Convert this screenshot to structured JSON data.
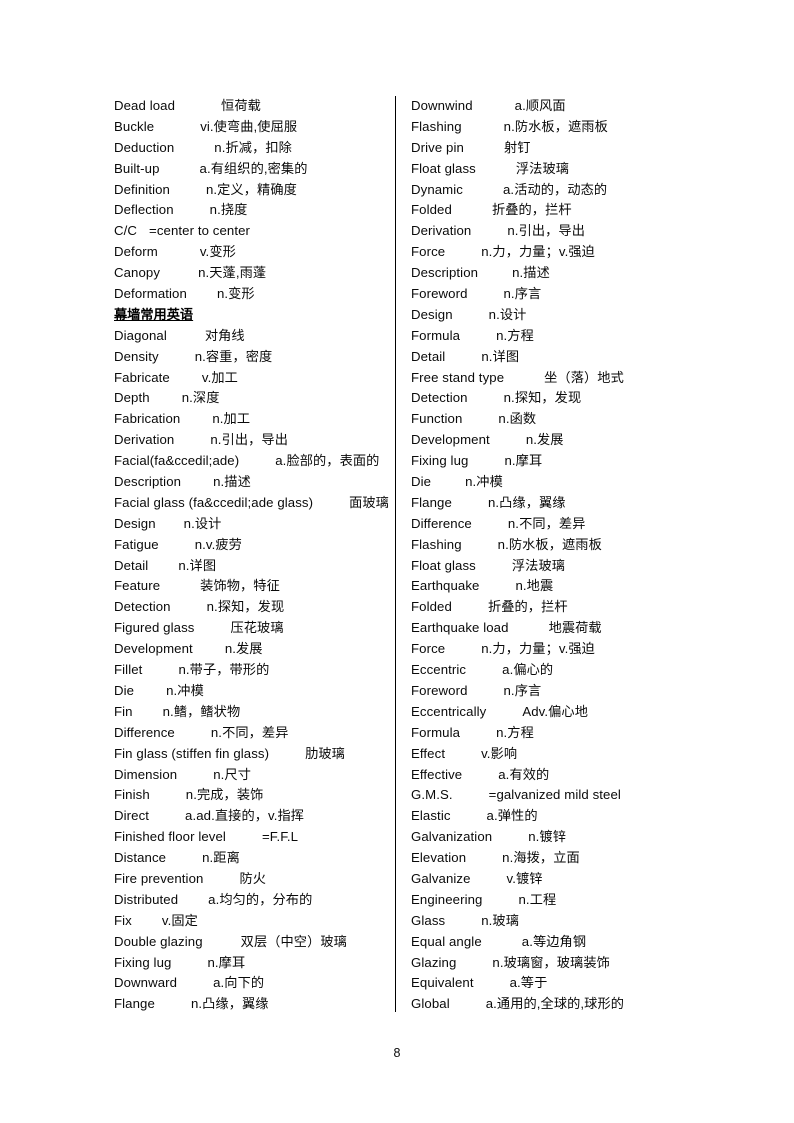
{
  "page": {
    "number": "8"
  },
  "columns": {
    "left": {
      "entries": [
        {
          "type": "entry",
          "term": "Dead load",
          "gap": 46,
          "def": "恒荷载"
        },
        {
          "type": "entry",
          "term": "Buckle",
          "gap": 46,
          "def": "vi.使弯曲,使屈服"
        },
        {
          "type": "entry",
          "term": "Deduction",
          "gap": 40,
          "def": "n.折减，扣除"
        },
        {
          "type": "entry",
          "term": "Built-up",
          "gap": 40,
          "def": "a.有组织的,密集的"
        },
        {
          "type": "entry",
          "term": "Definition",
          "gap": 36,
          "def": "n.定义，精确度"
        },
        {
          "type": "entry",
          "term": "Deflection",
          "gap": 36,
          "def": "n.挠度"
        },
        {
          "type": "entry",
          "term": "C/C",
          "gap": 12,
          "def": "=center to center"
        },
        {
          "type": "entry",
          "term": "Deform",
          "gap": 42,
          "def": "v.变形"
        },
        {
          "type": "entry",
          "term": "Canopy",
          "gap": 38,
          "def": "n.天蓬,雨蓬"
        },
        {
          "type": "entry",
          "term": "Deformation",
          "gap": 30,
          "def": "n.变形"
        },
        {
          "type": "head",
          "text": "幕墙常用英语"
        },
        {
          "type": "entry",
          "term": "Diagonal",
          "gap": 38,
          "def": "对角线"
        },
        {
          "type": "entry",
          "term": "Density",
          "gap": 36,
          "def": "n.容重，密度"
        },
        {
          "type": "entry",
          "term": "Fabricate",
          "gap": 32,
          "def": "v.加工"
        },
        {
          "type": "entry",
          "term": "Depth",
          "gap": 32,
          "def": "n.深度"
        },
        {
          "type": "entry",
          "term": "Fabrication",
          "gap": 32,
          "def": "n.加工"
        },
        {
          "type": "entry",
          "term": "Derivation",
          "gap": 36,
          "def": "n.引出，导出"
        },
        {
          "type": "entry",
          "term": "Facial(fa&ccedil;ade)",
          "gap": 36,
          "def": "a.脸部的，表面的"
        },
        {
          "type": "entry",
          "term": "Description",
          "gap": 32,
          "def": "n.描述"
        },
        {
          "type": "entry",
          "term": "Facial glass (fa&ccedil;ade glass)",
          "gap": 36,
          "def": "面玻璃"
        },
        {
          "type": "entry",
          "term": "Design",
          "gap": 28,
          "def": "n.设计"
        },
        {
          "type": "entry",
          "term": "Fatigue",
          "gap": 36,
          "def": "n.v.疲劳"
        },
        {
          "type": "entry",
          "term": "Detail",
          "gap": 30,
          "def": "n.详图"
        },
        {
          "type": "entry",
          "term": "Feature",
          "gap": 40,
          "def": "装饰物，特征"
        },
        {
          "type": "entry",
          "term": "Detection",
          "gap": 36,
          "def": "n.探知，发现"
        },
        {
          "type": "entry",
          "term": "Figured glass",
          "gap": 36,
          "def": "压花玻璃"
        },
        {
          "type": "entry",
          "term": "Development",
          "gap": 32,
          "def": "n.发展"
        },
        {
          "type": "entry",
          "term": "Fillet",
          "gap": 36,
          "def": "n.带子，带形的"
        },
        {
          "type": "entry",
          "term": "Die",
          "gap": 32,
          "def": "n.冲模"
        },
        {
          "type": "entry",
          "term": "Fin",
          "gap": 30,
          "def": "n.鳍，鳍状物"
        },
        {
          "type": "entry",
          "term": "Difference",
          "gap": 36,
          "def": "n.不同，差异"
        },
        {
          "type": "entry",
          "term": "Fin glass (stiffen fin glass)",
          "gap": 36,
          "def": "肋玻璃"
        },
        {
          "type": "entry",
          "term": "Dimension",
          "gap": 36,
          "def": "n.尺寸"
        },
        {
          "type": "entry",
          "term": "Finish",
          "gap": 36,
          "def": "n.完成，装饰"
        },
        {
          "type": "entry",
          "term": "Direct",
          "gap": 36,
          "def": "a.ad.直接的，v.指挥"
        },
        {
          "type": "entry",
          "term": "Finished floor level",
          "gap": 36,
          "def": "=F.F.L"
        },
        {
          "type": "entry",
          "term": "Distance",
          "gap": 36,
          "def": "n.距离"
        },
        {
          "type": "entry",
          "term": "Fire prevention",
          "gap": 36,
          "def": "防火"
        },
        {
          "type": "entry",
          "term": "Distributed",
          "gap": 30,
          "def": "a.均匀的，分布的"
        },
        {
          "type": "entry",
          "term": "Fix",
          "gap": 30,
          "def": "v.固定"
        },
        {
          "type": "entry",
          "term": "Double glazing",
          "gap": 38,
          "def": "双层（中空）玻璃"
        },
        {
          "type": "entry",
          "term": "Fixing lug",
          "gap": 36,
          "def": "n.摩耳"
        },
        {
          "type": "entry",
          "term": "Downward",
          "gap": 36,
          "def": "a.向下的"
        },
        {
          "type": "entry",
          "term": "Flange",
          "gap": 36,
          "def": "n.凸缘，翼缘"
        }
      ]
    },
    "right": {
      "entries": [
        {
          "type": "entry",
          "term": "Downwind",
          "gap": 42,
          "def": "a.顺风面"
        },
        {
          "type": "entry",
          "term": "Flashing",
          "gap": 42,
          "def": "n.防水板，遮雨板"
        },
        {
          "type": "entry",
          "term": "Drive pin",
          "gap": 40,
          "def": "射钉"
        },
        {
          "type": "entry",
          "term": "Float glass",
          "gap": 40,
          "def": "浮法玻璃"
        },
        {
          "type": "entry",
          "term": "Dynamic",
          "gap": 40,
          "def": "a.活动的，动态的"
        },
        {
          "type": "entry",
          "term": "Folded",
          "gap": 40,
          "def": "折叠的，拦杆"
        },
        {
          "type": "entry",
          "term": "Derivation",
          "gap": 36,
          "def": "n.引出，导出"
        },
        {
          "type": "entry",
          "term": "Force",
          "gap": 36,
          "def": "n.力，力量；v.强迫"
        },
        {
          "type": "entry",
          "term": "Description",
          "gap": 34,
          "def": "n.描述"
        },
        {
          "type": "entry",
          "term": "Foreword",
          "gap": 36,
          "def": "n.序言"
        },
        {
          "type": "entry",
          "term": "Design",
          "gap": 36,
          "def": "n.设计"
        },
        {
          "type": "entry",
          "term": "Formula",
          "gap": 36,
          "def": "n.方程"
        },
        {
          "type": "entry",
          "term": "Detail",
          "gap": 36,
          "def": "n.详图"
        },
        {
          "type": "entry",
          "term": "Free stand type",
          "gap": 40,
          "def": "坐（落）地式"
        },
        {
          "type": "entry",
          "term": "Detection",
          "gap": 36,
          "def": "n.探知，发现"
        },
        {
          "type": "entry",
          "term": "Function",
          "gap": 36,
          "def": "n.函数"
        },
        {
          "type": "entry",
          "term": "Development",
          "gap": 36,
          "def": "n.发展"
        },
        {
          "type": "entry",
          "term": "Fixing lug",
          "gap": 36,
          "def": "n.摩耳"
        },
        {
          "type": "entry",
          "term": "Die",
          "gap": 34,
          "def": "n.冲模"
        },
        {
          "type": "entry",
          "term": "Flange",
          "gap": 36,
          "def": "n.凸缘，翼缘"
        },
        {
          "type": "entry",
          "term": "Difference",
          "gap": 36,
          "def": "n.不同，差异"
        },
        {
          "type": "entry",
          "term": "Flashing",
          "gap": 36,
          "def": "n.防水板，遮雨板"
        },
        {
          "type": "entry",
          "term": "Float glass",
          "gap": 36,
          "def": "浮法玻璃"
        },
        {
          "type": "entry",
          "term": "Earthquake",
          "gap": 36,
          "def": "n.地震"
        },
        {
          "type": "entry",
          "term": "Folded",
          "gap": 36,
          "def": "折叠的，拦杆"
        },
        {
          "type": "entry",
          "term": "Earthquake load",
          "gap": 40,
          "def": "地震荷载"
        },
        {
          "type": "entry",
          "term": "Force",
          "gap": 36,
          "def": "n.力，力量；v.强迫"
        },
        {
          "type": "entry",
          "term": "Eccentric",
          "gap": 36,
          "def": "a.偏心的"
        },
        {
          "type": "entry",
          "term": "Foreword",
          "gap": 36,
          "def": "n.序言"
        },
        {
          "type": "entry",
          "term": "Eccentrically",
          "gap": 36,
          "def": "Adv.偏心地"
        },
        {
          "type": "entry",
          "term": "Formula",
          "gap": 36,
          "def": "n.方程"
        },
        {
          "type": "entry",
          "term": "Effect",
          "gap": 36,
          "def": "v.影响"
        },
        {
          "type": "entry",
          "term": "Effective",
          "gap": 36,
          "def": "a.有效的"
        },
        {
          "type": "entry",
          "term": "G.M.S.",
          "gap": 36,
          "def": "=galvanized mild steel"
        },
        {
          "type": "entry",
          "term": "Elastic",
          "gap": 36,
          "def": "a.弹性的"
        },
        {
          "type": "entry",
          "term": "Galvanization",
          "gap": 36,
          "def": "n.镀锌"
        },
        {
          "type": "entry",
          "term": "Elevation",
          "gap": 36,
          "def": "n.海拨，立面"
        },
        {
          "type": "entry",
          "term": "Galvanize",
          "gap": 36,
          "def": "v.镀锌"
        },
        {
          "type": "entry",
          "term": "Engineering",
          "gap": 36,
          "def": "n.工程"
        },
        {
          "type": "entry",
          "term": "Glass",
          "gap": 36,
          "def": "n.玻璃"
        },
        {
          "type": "entry",
          "term": "Equal angle",
          "gap": 40,
          "def": "a.等边角钢"
        },
        {
          "type": "entry",
          "term": "Glazing",
          "gap": 36,
          "def": "n.玻璃窗，玻璃装饰"
        },
        {
          "type": "entry",
          "term": "Equivalent",
          "gap": 36,
          "def": "a.等于"
        },
        {
          "type": "entry",
          "term": "Global",
          "gap": 36,
          "def": "a.通用的,全球的,球形的"
        }
      ]
    }
  }
}
